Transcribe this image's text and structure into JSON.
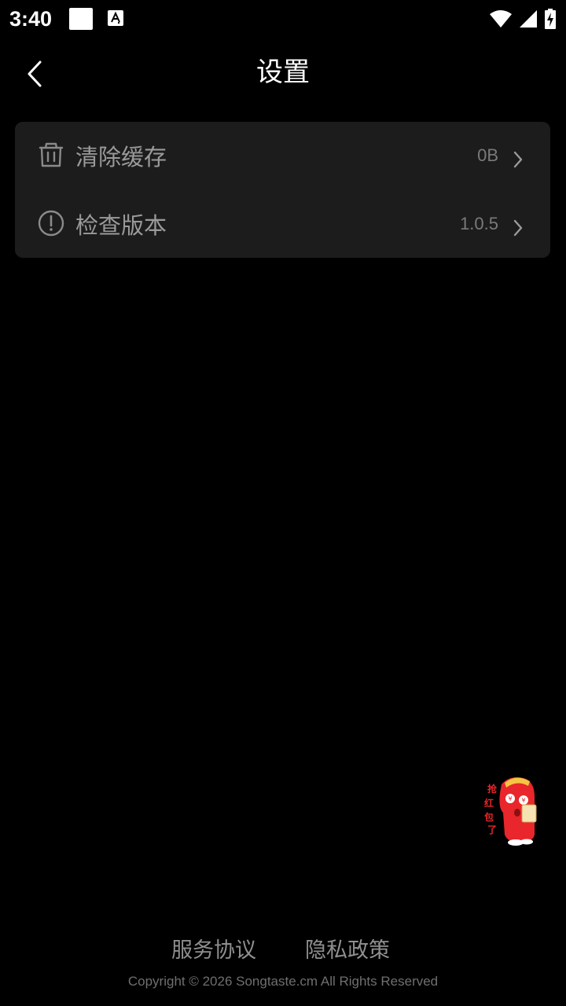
{
  "status_bar": {
    "time": "3:40",
    "icons": [
      "notification-square-icon",
      "a-font-icon",
      "wifi-icon",
      "cell-signal-icon",
      "battery-charging-icon"
    ]
  },
  "header": {
    "title": "设置",
    "back_icon": "chevron-left-icon"
  },
  "settings": {
    "items": [
      {
        "icon": "trash-icon",
        "label": "清除缓存",
        "value": "0B",
        "chevron": "chevron-right-icon"
      },
      {
        "icon": "info-circle-icon",
        "label": "检查版本",
        "value": "1.0.5",
        "chevron": "chevron-right-icon"
      }
    ]
  },
  "floating": {
    "mascot_icon": "red-envelope-mascot-icon",
    "mascot_text": "抢红包了"
  },
  "footer": {
    "links": [
      "服务协议",
      "隐私政策"
    ],
    "copyright": "Copyright © 2026 Songtaste.cm All Rights Reserved"
  },
  "colors": {
    "background": "#000000",
    "card": "#1c1c1c",
    "label": "#9a9a9a",
    "value": "#7a7a7a",
    "footer_link": "#8f8f8f",
    "mascot_red": "#e8262b"
  }
}
